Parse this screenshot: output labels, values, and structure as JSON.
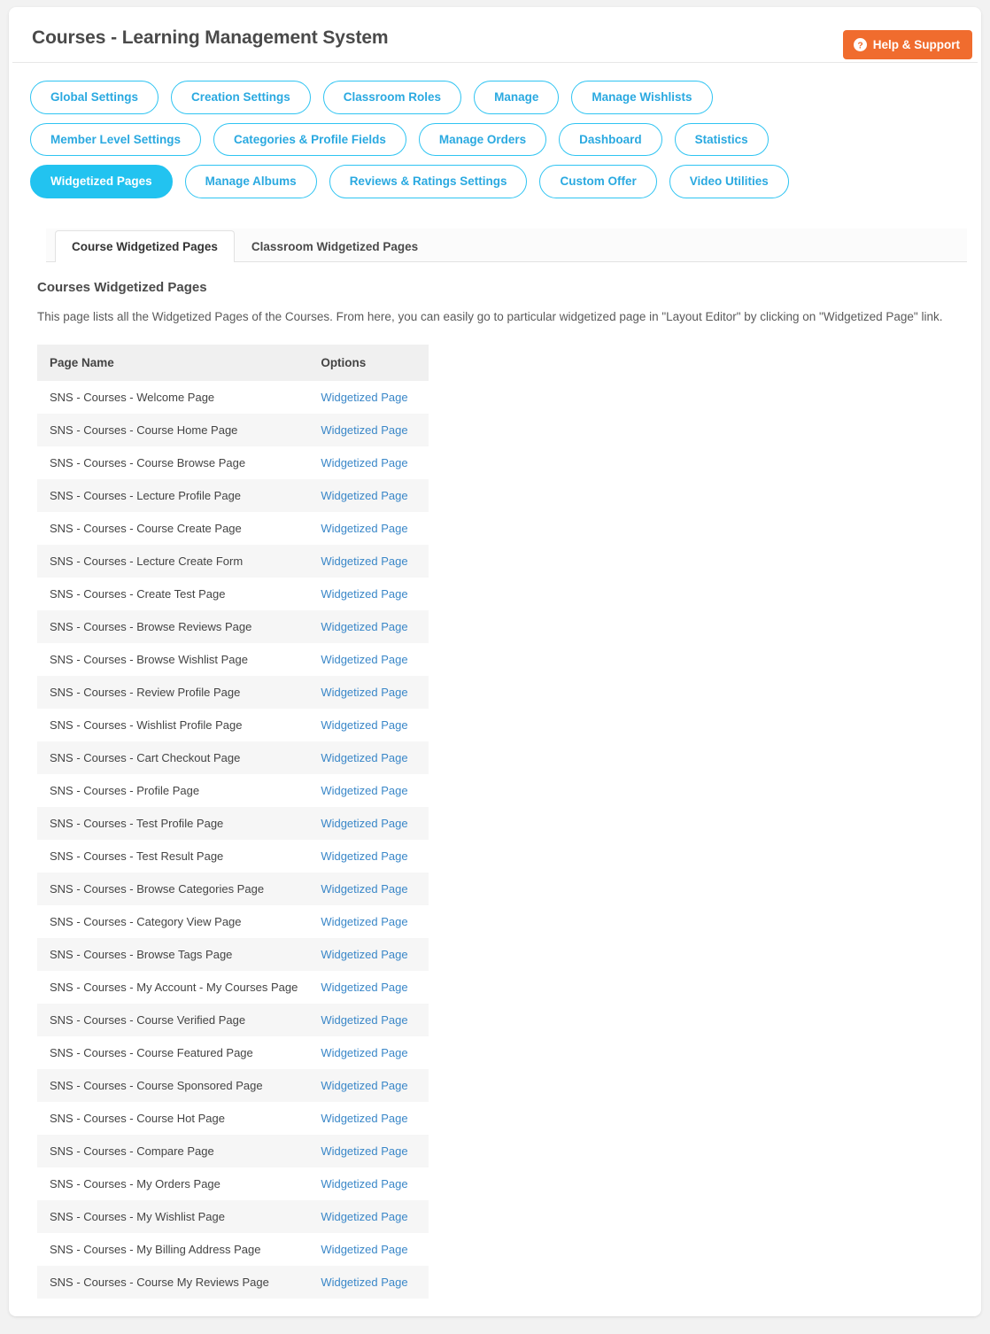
{
  "header": {
    "title": "Courses - Learning Management System",
    "help_button": "Help & Support",
    "help_icon": "question-circle-icon"
  },
  "nav": {
    "pills": [
      {
        "label": "Global Settings",
        "active": false
      },
      {
        "label": "Creation Settings",
        "active": false
      },
      {
        "label": "Classroom Roles",
        "active": false
      },
      {
        "label": "Manage",
        "active": false
      },
      {
        "label": "Manage Wishlists",
        "active": false
      },
      {
        "label": "Member Level Settings",
        "active": false
      },
      {
        "label": "Categories & Profile Fields",
        "active": false
      },
      {
        "label": "Manage Orders",
        "active": false
      },
      {
        "label": "Dashboard",
        "active": false
      },
      {
        "label": "Statistics",
        "active": false
      },
      {
        "label": "Widgetized Pages",
        "active": true
      },
      {
        "label": "Manage Albums",
        "active": false
      },
      {
        "label": "Reviews & Ratings Settings",
        "active": false
      },
      {
        "label": "Custom Offer",
        "active": false
      },
      {
        "label": "Video Utilities",
        "active": false
      }
    ]
  },
  "tabs": [
    {
      "label": "Course Widgetized Pages",
      "active": true
    },
    {
      "label": "Classroom Widgetized Pages",
      "active": false
    }
  ],
  "main": {
    "section_title": "Courses Widgetized Pages",
    "section_desc": "This page lists all the Widgetized Pages of the Courses. From here, you can easily go to particular widgetized page in \"Layout Editor\" by clicking on \"Widgetized Page\" link."
  },
  "table": {
    "columns": [
      "Page Name",
      "Options"
    ],
    "option_link_label": "Widgetized Page",
    "rows": [
      "SNS - Courses - Welcome Page",
      "SNS - Courses - Course Home Page",
      "SNS - Courses - Course Browse Page",
      "SNS - Courses - Lecture Profile Page",
      "SNS - Courses - Course Create Page",
      "SNS - Courses - Lecture Create Form",
      "SNS - Courses - Create Test Page",
      "SNS - Courses - Browse Reviews Page",
      "SNS - Courses - Browse Wishlist Page",
      "SNS - Courses - Review Profile Page",
      "SNS - Courses - Wishlist Profile Page",
      "SNS - Courses - Cart Checkout Page",
      "SNS - Courses - Profile Page",
      "SNS - Courses - Test Profile Page",
      "SNS - Courses - Test Result Page",
      "SNS - Courses - Browse Categories Page",
      "SNS - Courses - Category View Page",
      "SNS - Courses - Browse Tags Page",
      "SNS - Courses - My Account - My Courses Page",
      "SNS - Courses - Course Verified Page",
      "SNS - Courses - Course Featured Page",
      "SNS - Courses - Course Sponsored Page",
      "SNS - Courses - Course Hot Page",
      "SNS - Courses - Compare Page",
      "SNS - Courses - My Orders Page",
      "SNS - Courses - My Wishlist Page",
      "SNS - Courses - My Billing Address Page",
      "SNS - Courses - Course My Reviews Page"
    ]
  },
  "colors": {
    "accent": "#22c3f0",
    "accent_text": "#2aa9e0",
    "help_orange": "#f06c2e",
    "link_blue": "#3a87c8",
    "page_bg": "#f2f2f2",
    "row_stripe": "#f6f6f6",
    "table_header_bg": "#f0f0f0"
  }
}
